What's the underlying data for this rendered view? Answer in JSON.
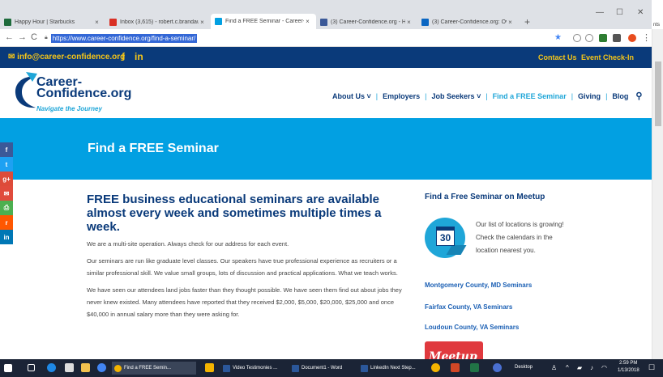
{
  "browser": {
    "tabs": [
      {
        "title": "Happy Hour | Starbucks",
        "close": "×",
        "color": "#1e6b3c"
      },
      {
        "title": "Inbox (3,615) - robert.c.brandau@...",
        "close": "×",
        "color": "#d93025"
      },
      {
        "title": "Find a FREE Seminar - Career-Co...",
        "close": "×",
        "color": "#02a0e2"
      },
      {
        "title": "(3) Career-Confidence.org - Hom...",
        "close": "×",
        "color": "#3b5998"
      },
      {
        "title": "(3) Career-Confidence.org: Overv...",
        "close": "×",
        "color": "#0a66c2"
      }
    ],
    "new_tab": "+",
    "window": {
      "minimize": "—",
      "restore": "☐",
      "close": "✕"
    },
    "nav": {
      "back": "←",
      "forward": "→",
      "reload": "C"
    },
    "url": "https://www.career-confidence.org/find-a-seminar/",
    "bookmark_star": "★",
    "side_fragment": "nts"
  },
  "site": {
    "topbar": {
      "email": "info@career-confidence.org",
      "facebook": "f",
      "linkedin": "in",
      "contact": "Contact Us",
      "event_checkin": "Event Check-In"
    },
    "logo": {
      "line1": "Career-",
      "line2": "Confidence.org",
      "tagline": "Navigate the Journey"
    },
    "nav": {
      "about": "About Us",
      "employers": "Employers",
      "job_seekers": "Job Seekers",
      "seminar": "Find a FREE Seminar",
      "giving": "Giving",
      "blog": "Blog",
      "caret": "˅",
      "sep": "|",
      "search": "⚲"
    },
    "hero_title": "Find a FREE Seminar",
    "share": [
      {
        "glyph": "f",
        "color": "#3b5998"
      },
      {
        "glyph": "t",
        "color": "#1da1f2"
      },
      {
        "glyph": "g+",
        "color": "#dd4b39"
      },
      {
        "glyph": "✉",
        "color": "#e04b3c"
      },
      {
        "glyph": "⎙",
        "color": "#4caf50"
      },
      {
        "glyph": "r",
        "color": "#ff5700"
      },
      {
        "glyph": "in",
        "color": "#0077b5"
      }
    ],
    "main": {
      "heading": "FREE business educational seminars are available almost every week and sometimes multiple times a week.",
      "p1": "We are a multi-site operation. Always check for our address for each event.",
      "p2": "Our seminars are run like graduate level classes. Our speakers have true professional experience as recruiters or a similar professional skill. We value small groups, lots of discussion and practical applications. What we teach works.",
      "p3": "We have seen our attendees land jobs faster than they thought possible. We have seen them find out about jobs they never knew existed. Many attendees have reported that they received $2,000, $5,000, $20,000, $25,000 and once $40,000 in annual salary more than they were asking for."
    },
    "sidebar": {
      "heading": "Find a Free Seminar on Meetup",
      "calendar_day": "30",
      "note": "Our list of locations is growing! Check the calendars in the location nearest you.",
      "links": [
        "Montgomery County, MD Seminars",
        "Fairfax County, VA Seminars",
        "Loudoun County, VA Seminars"
      ],
      "meetup_logo": "Meetup"
    }
  },
  "taskbar": {
    "items": [
      {
        "label": "Find a FREE Semin...",
        "color": "#f4b400"
      },
      {
        "label": "Video Testimonies ...",
        "color": "#2b579a"
      },
      {
        "label": "Document1 - Word",
        "color": "#2b579a"
      },
      {
        "label": "LinkedIn Next Step...",
        "color": "#2b579a"
      }
    ],
    "desktop": "Desktop",
    "time": "2:59 PM",
    "date": "1/13/2018"
  }
}
